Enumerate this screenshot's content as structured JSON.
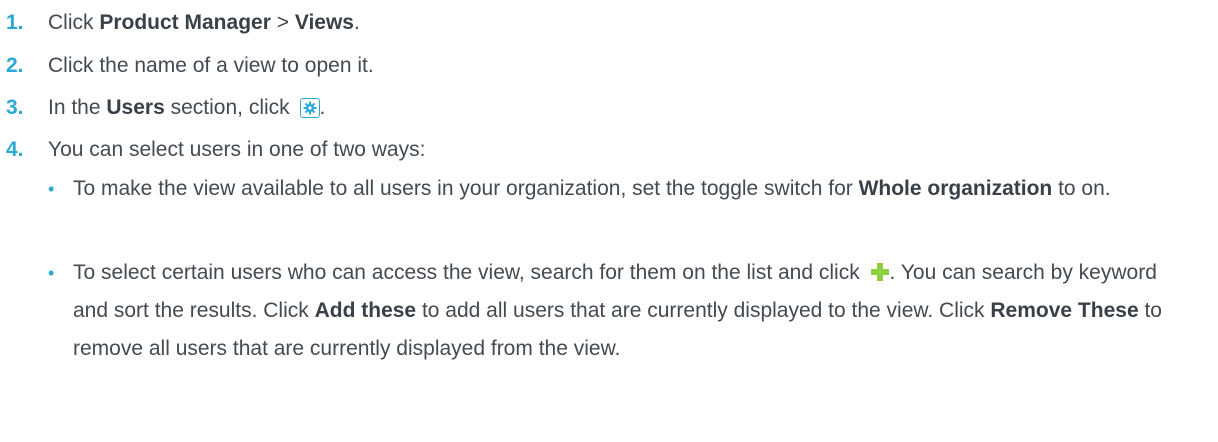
{
  "steps": [
    {
      "num": "1.",
      "pre": "Click ",
      "b1": "Product Manager",
      "mid": " > ",
      "b2": "Views",
      "post": "."
    },
    {
      "num": "2.",
      "text": "Click the name of a view to open it."
    },
    {
      "num": "3.",
      "pre": "In the ",
      "b1": "Users",
      "post": " section, click ",
      "end": "."
    },
    {
      "num": "4.",
      "text": "You can select users in one of two ways:"
    }
  ],
  "bullets": [
    {
      "pre": "To make the view available to all users in your organization, set the toggle switch for ",
      "b1": "Whole organization",
      "post": " to on."
    },
    {
      "pre": "To select certain users who can access the view, search for them on the list and click ",
      "after_icon": ". You can search by keyword and sort the results. Click ",
      "b1": "Add these",
      "mid": " to add all users that are currently displayed to the view. Click ",
      "b2": "Remove These",
      "post": " to remove all users that are currently displayed from the view."
    }
  ],
  "icons": {
    "gear": "gear-icon",
    "plus": "plus-icon",
    "accent": "#2aa9d4",
    "plus_color": "#8ccf3f"
  }
}
